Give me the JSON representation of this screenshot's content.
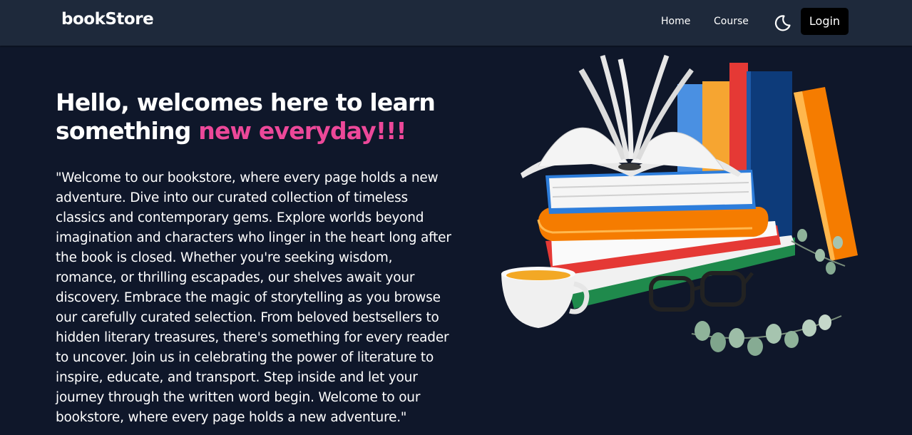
{
  "nav": {
    "brand": "bookStore",
    "links": [
      {
        "label": "Home"
      },
      {
        "label": "Course"
      }
    ],
    "theme_icon": "moon-icon",
    "login_label": "Login"
  },
  "hero": {
    "title_main": "Hello, welcomes here to learn something ",
    "title_accent": "new everyday!!!",
    "description": "\"Welcome to our bookstore, where every page holds a new adventure. Dive into our curated collection of timeless classics and contemporary gems. Explore worlds beyond imagination and characters who linger in the heart long after the book is closed. Whether you're seeking wisdom, romance, or thrilling escapades, our shelves await your discovery. Embrace the magic of storytelling as you browse our carefully curated selection. From beloved bestsellers to hidden literary treasures, there's something for every reader to uncover. Join us in celebrating the power of literature to inspire, educate, and transport. Step inside and let your journey through the written word begin. Welcome to our bookstore, where every page holds a new adventure.\"",
    "image_icon": "books-stack-illustration"
  },
  "colors": {
    "page_bg": "#0f172a",
    "nav_bg": "#1e293b",
    "accent": "#ec4899",
    "login_bg": "#000000"
  }
}
